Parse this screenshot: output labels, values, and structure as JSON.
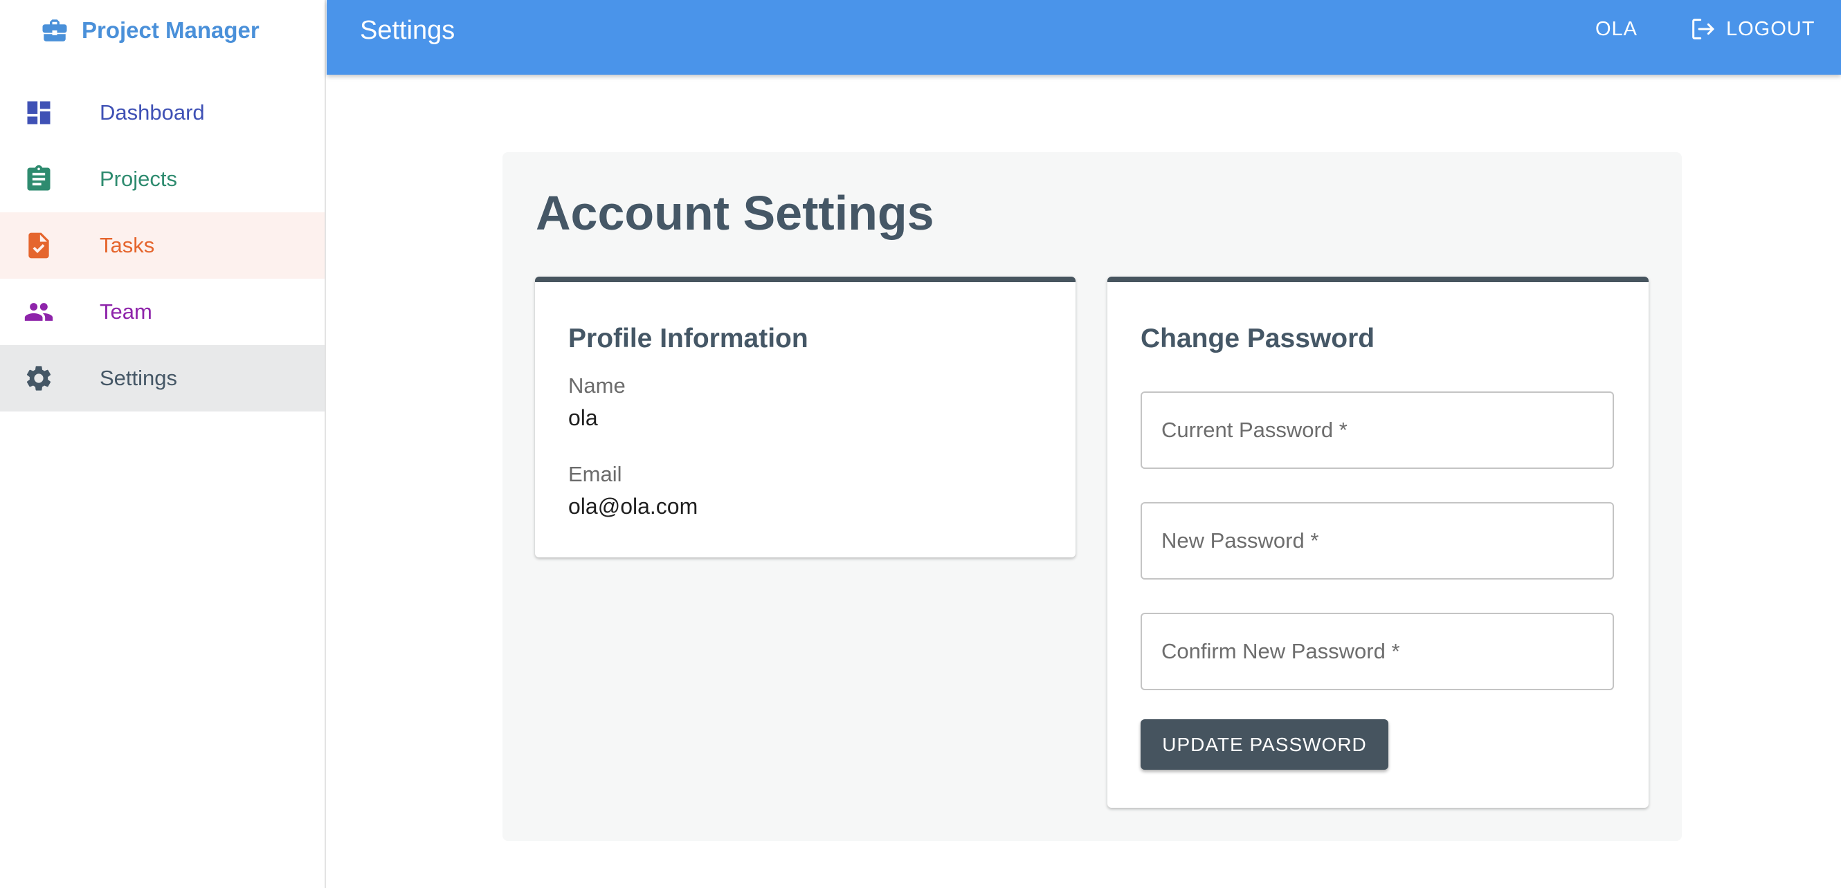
{
  "app": {
    "brand": "Project Manager",
    "brand_icon": "briefcase-icon"
  },
  "colors": {
    "topbar": "#4a94ea",
    "brand": "#4a90d9",
    "dashboard": "#3f51b5",
    "projects": "#2e8b6f",
    "tasks": "#e5652d",
    "team": "#8e24aa",
    "settings": "#455766",
    "card_accent": "#47555f"
  },
  "sidebar": {
    "items": [
      {
        "label": "Dashboard",
        "icon": "dashboard-icon"
      },
      {
        "label": "Projects",
        "icon": "clipboard-icon"
      },
      {
        "label": "Tasks",
        "icon": "task-file-icon"
      },
      {
        "label": "Team",
        "icon": "people-icon"
      },
      {
        "label": "Settings",
        "icon": "gear-icon"
      }
    ]
  },
  "header": {
    "title": "Settings",
    "user": "OLA",
    "logout_label": "LOGOUT",
    "logout_icon": "logout-icon"
  },
  "main": {
    "title": "Account Settings",
    "profile": {
      "heading": "Profile Information",
      "name_label": "Name",
      "name_value": "ola",
      "email_label": "Email",
      "email_value": "ola@ola.com"
    },
    "password": {
      "heading": "Change Password",
      "current_placeholder": "Current Password *",
      "new_placeholder": "New Password *",
      "confirm_placeholder": "Confirm New Password *",
      "submit_label": "UPDATE PASSWORD"
    }
  }
}
